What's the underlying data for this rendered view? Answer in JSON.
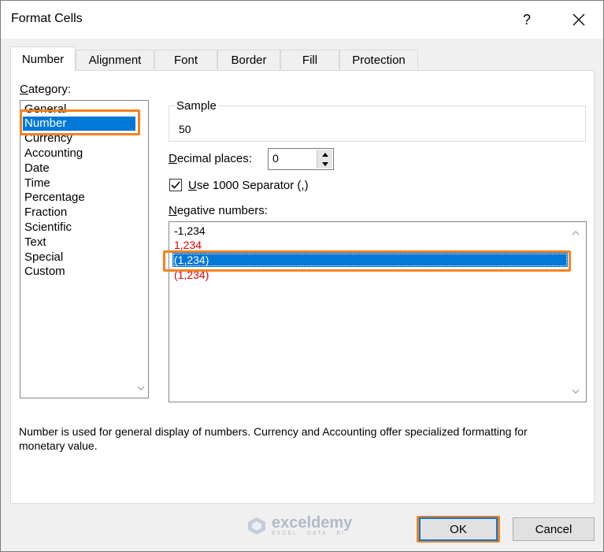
{
  "window": {
    "title": "Format Cells",
    "help": "?"
  },
  "tabs": [
    {
      "label": "Number",
      "active": true
    },
    {
      "label": "Alignment",
      "active": false
    },
    {
      "label": "Font",
      "active": false
    },
    {
      "label": "Border",
      "active": false
    },
    {
      "label": "Fill",
      "active": false
    },
    {
      "label": "Protection",
      "active": false
    }
  ],
  "category": {
    "label_underlined": "C",
    "label_rest": "ategory:",
    "items": [
      "General",
      "Number",
      "Currency",
      "Accounting",
      "Date",
      "Time",
      "Percentage",
      "Fraction",
      "Scientific",
      "Text",
      "Special",
      "Custom"
    ],
    "selected": "Number"
  },
  "sample": {
    "label": "Sample",
    "value": "50"
  },
  "decimal": {
    "label_underlined": "D",
    "label_rest": "ecimal places:",
    "value": "0"
  },
  "separator": {
    "label_underlined": "U",
    "label_rest": "se 1000 Separator (,)",
    "checked": true
  },
  "negative": {
    "label_underlined": "N",
    "label_rest": "egative numbers:",
    "items": [
      {
        "text": "-1,234",
        "color": "#000000"
      },
      {
        "text": "1,234",
        "color": "#e00000"
      },
      {
        "text": "(1,234)",
        "color": "#000000",
        "selected": true
      },
      {
        "text": "(1,234)",
        "color": "#e00000"
      }
    ]
  },
  "description": "Number is used for general display of numbers.  Currency and Accounting offer specialized formatting for monetary value.",
  "buttons": {
    "ok": "OK",
    "cancel": "Cancel"
  },
  "watermark": {
    "name": "exceldemy",
    "tagline": "EXCEL · DATA · BI"
  },
  "colors": {
    "selection": "#0078d7",
    "highlight": "#f58220",
    "negative_red": "#e00000"
  }
}
